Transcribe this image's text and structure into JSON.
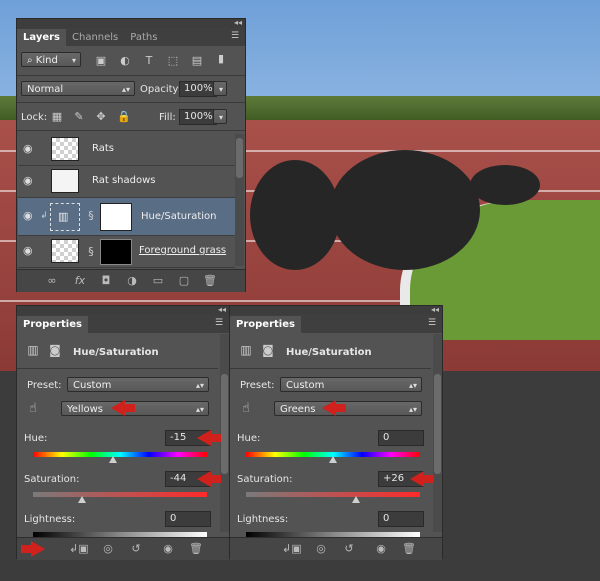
{
  "layers_panel": {
    "tabs": [
      "Layers",
      "Channels",
      "Paths"
    ],
    "filter_kind": "Kind",
    "blend_mode": "Normal",
    "opacity_label": "Opacity:",
    "opacity_value": "100%",
    "lock_label": "Lock:",
    "fill_label": "Fill:",
    "fill_value": "100%",
    "layers": [
      {
        "name": "Rats",
        "selected": false
      },
      {
        "name": "Rat shadows",
        "selected": false
      },
      {
        "name": "Hue/Saturation",
        "selected": true
      },
      {
        "name": "Foreground grass",
        "selected": false
      }
    ],
    "footer_icons": [
      "link-icon",
      "fx-icon",
      "mask-icon",
      "adjustment-icon",
      "group-icon",
      "new-layer-icon",
      "trash-icon"
    ]
  },
  "properties_left": {
    "tab": "Properties",
    "title": "Hue/Saturation",
    "preset_label": "Preset:",
    "preset_value": "Custom",
    "range_value": "Yellows",
    "hue_label": "Hue:",
    "hue_value": "-15",
    "hue_fraction": 0.46,
    "saturation_label": "Saturation:",
    "saturation_value": "-44",
    "saturation_fraction": 0.28,
    "lightness_label": "Lightness:",
    "lightness_value": "0"
  },
  "properties_right": {
    "tab": "Properties",
    "title": "Hue/Saturation",
    "preset_label": "Preset:",
    "preset_value": "Custom",
    "range_value": "Greens",
    "hue_label": "Hue:",
    "hue_value": "0",
    "hue_fraction": 0.5,
    "saturation_label": "Saturation:",
    "saturation_value": "+26",
    "saturation_fraction": 0.63,
    "lightness_label": "Lightness:",
    "lightness_value": "0"
  },
  "colors": {
    "arrow": "#d0211c",
    "selected_row": "#596d85",
    "panel": "#535353"
  }
}
